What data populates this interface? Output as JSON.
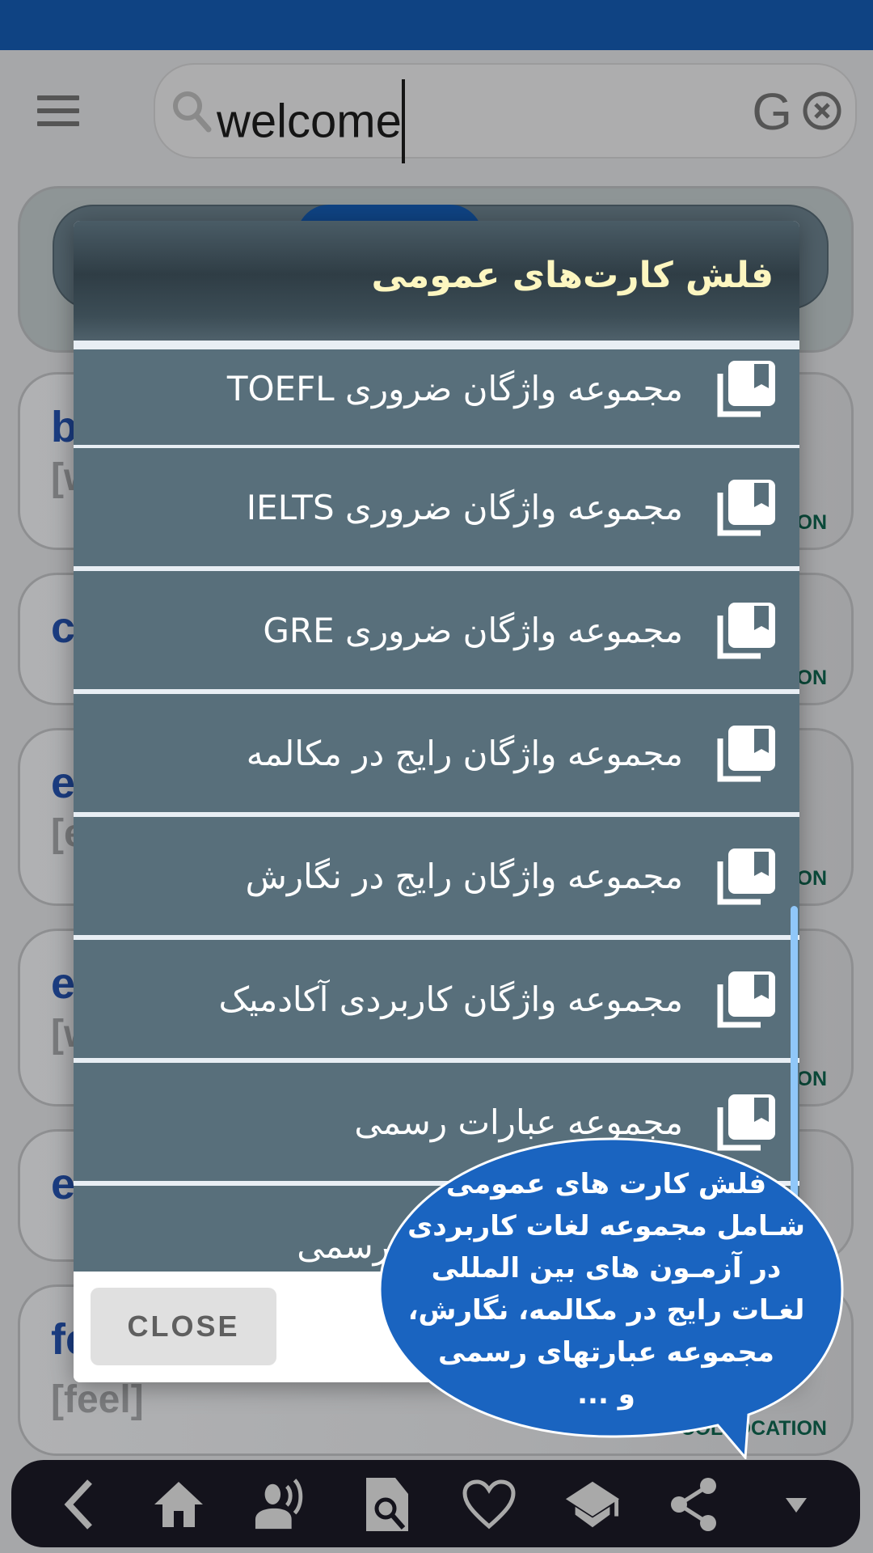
{
  "colors": {
    "status_bar": "#0f4383",
    "dialog_item_bg": "#586f7b",
    "dialog_title": "#fdf6c0",
    "bubble_bg": "#1a64c0",
    "scrollbar": "#90c7f9",
    "word_color": "#1b3d82",
    "tag_color": "#0b4a3a"
  },
  "header": {
    "menu_icon": "hamburger-menu-icon",
    "search": {
      "value": "welcome",
      "icon": "search-icon",
      "google_label": "G",
      "clear_icon": "clear-circle-icon"
    }
  },
  "background_cards": [
    {
      "word": "b",
      "phonetic": "[w",
      "tag": "ON"
    },
    {
      "word": "c",
      "phonetic": "",
      "tag": "ON"
    },
    {
      "word": "e",
      "phonetic": "[e",
      "tag": "ON"
    },
    {
      "word": "e",
      "phonetic": "[w",
      "tag": "ON"
    },
    {
      "word": "e",
      "phonetic": "",
      "tag": ""
    },
    {
      "word": "fe",
      "phonetic": "[feel]",
      "tag": "COLLOCATION"
    }
  ],
  "dialog": {
    "title": "فلش کارت‌های عمومی",
    "items": [
      {
        "label": "مجموعه واژگان ضروری TOEFL",
        "icon": "flashcard-collection-icon"
      },
      {
        "label": "مجموعه واژگان ضروری IELTS",
        "icon": "flashcard-collection-icon"
      },
      {
        "label": "مجموعه واژگان ضروری GRE",
        "icon": "flashcard-collection-icon"
      },
      {
        "label": "مجموعه واژگان رایج در مکالمه",
        "icon": "flashcard-collection-icon"
      },
      {
        "label": "مجموعه واژگان رایج در نگارش",
        "icon": "flashcard-collection-icon"
      },
      {
        "label": "مجموعه واژگان کاربردی آکادمیک",
        "icon": "flashcard-collection-icon"
      },
      {
        "label": "مجموعه عبارات رسمی",
        "icon": "flashcard-collection-icon"
      },
      {
        "label": "مجموعه عبارات غیر رسمی",
        "icon": "flashcard-collection-icon"
      }
    ],
    "close_label": "CLOSE"
  },
  "tooltip_bubble": {
    "lines": [
      "فلش کارت های عمومی",
      "شـامل مجموعه لغات کاربردی",
      "در آزمـون های بین المللی",
      "لغـات رایج در مکالمه، نگارش،",
      "مجموعه  عبارتهای رسمی",
      "و ..."
    ]
  },
  "bottom_nav": [
    {
      "name": "back",
      "icon": "chevron-left-icon"
    },
    {
      "name": "home",
      "icon": "home-icon"
    },
    {
      "name": "pronunciation",
      "icon": "voice-speaker-icon"
    },
    {
      "name": "search-document",
      "icon": "document-search-icon"
    },
    {
      "name": "favorites",
      "icon": "heart-icon"
    },
    {
      "name": "learning",
      "icon": "graduation-cap-icon"
    },
    {
      "name": "share",
      "icon": "share-icon"
    },
    {
      "name": "more",
      "icon": "dropdown-arrow-icon"
    }
  ]
}
